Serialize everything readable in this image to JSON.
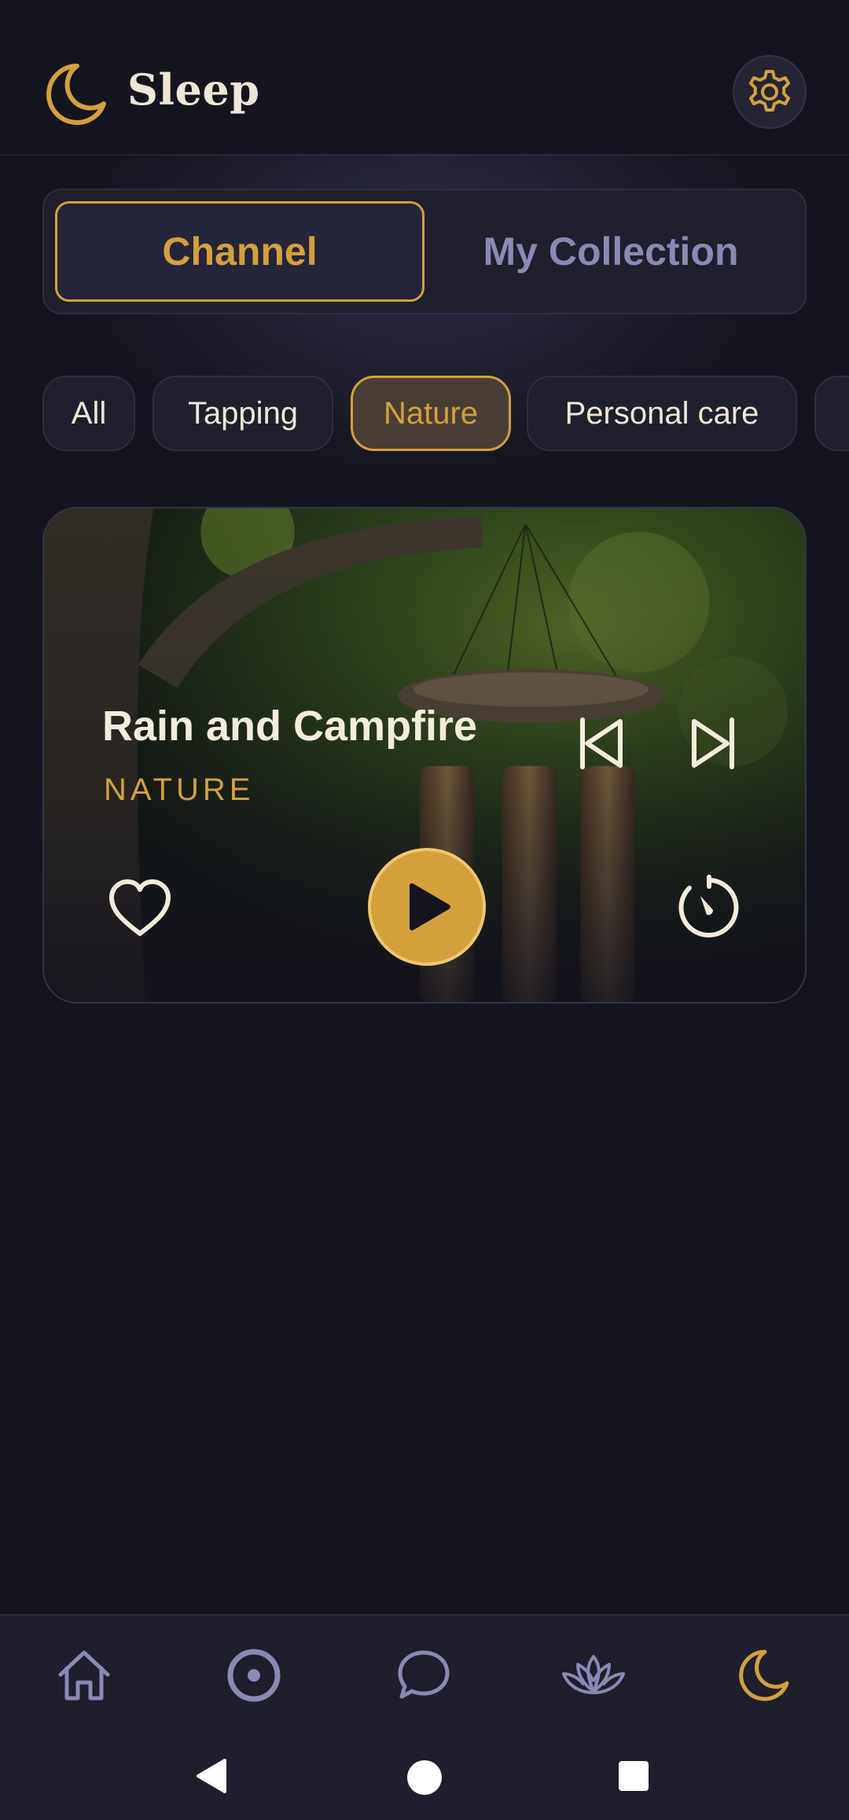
{
  "header": {
    "title": "Sleep",
    "logo_icon": "crescent-moon-icon",
    "settings_icon": "gear-icon"
  },
  "tabs": [
    {
      "label": "Channel",
      "active": true
    },
    {
      "label": "My Collection",
      "active": false
    }
  ],
  "filters": [
    {
      "label": "All",
      "active": false
    },
    {
      "label": "Tapping",
      "active": false
    },
    {
      "label": "Nature",
      "active": true
    },
    {
      "label": "Personal care",
      "active": false
    }
  ],
  "player": {
    "title": "Rain and Campfire",
    "category": "NATURE",
    "controls": [
      "skip-previous-icon",
      "skip-next-icon",
      "heart-icon",
      "play-icon",
      "timer-icon"
    ]
  },
  "bottom_nav": {
    "items": [
      {
        "icon": "home-icon",
        "active": false
      },
      {
        "icon": "focus-circle-icon",
        "active": false
      },
      {
        "icon": "chat-bubble-icon",
        "active": false
      },
      {
        "icon": "lotus-icon",
        "active": false
      },
      {
        "icon": "moon-icon",
        "active": true
      }
    ]
  },
  "system_nav": [
    "back-icon",
    "home-circle-icon",
    "recents-square-icon"
  ],
  "colors": {
    "accent": "#d4a03c",
    "background": "#15151f",
    "muted": "#8c88b4",
    "text": "#efe7d6"
  }
}
